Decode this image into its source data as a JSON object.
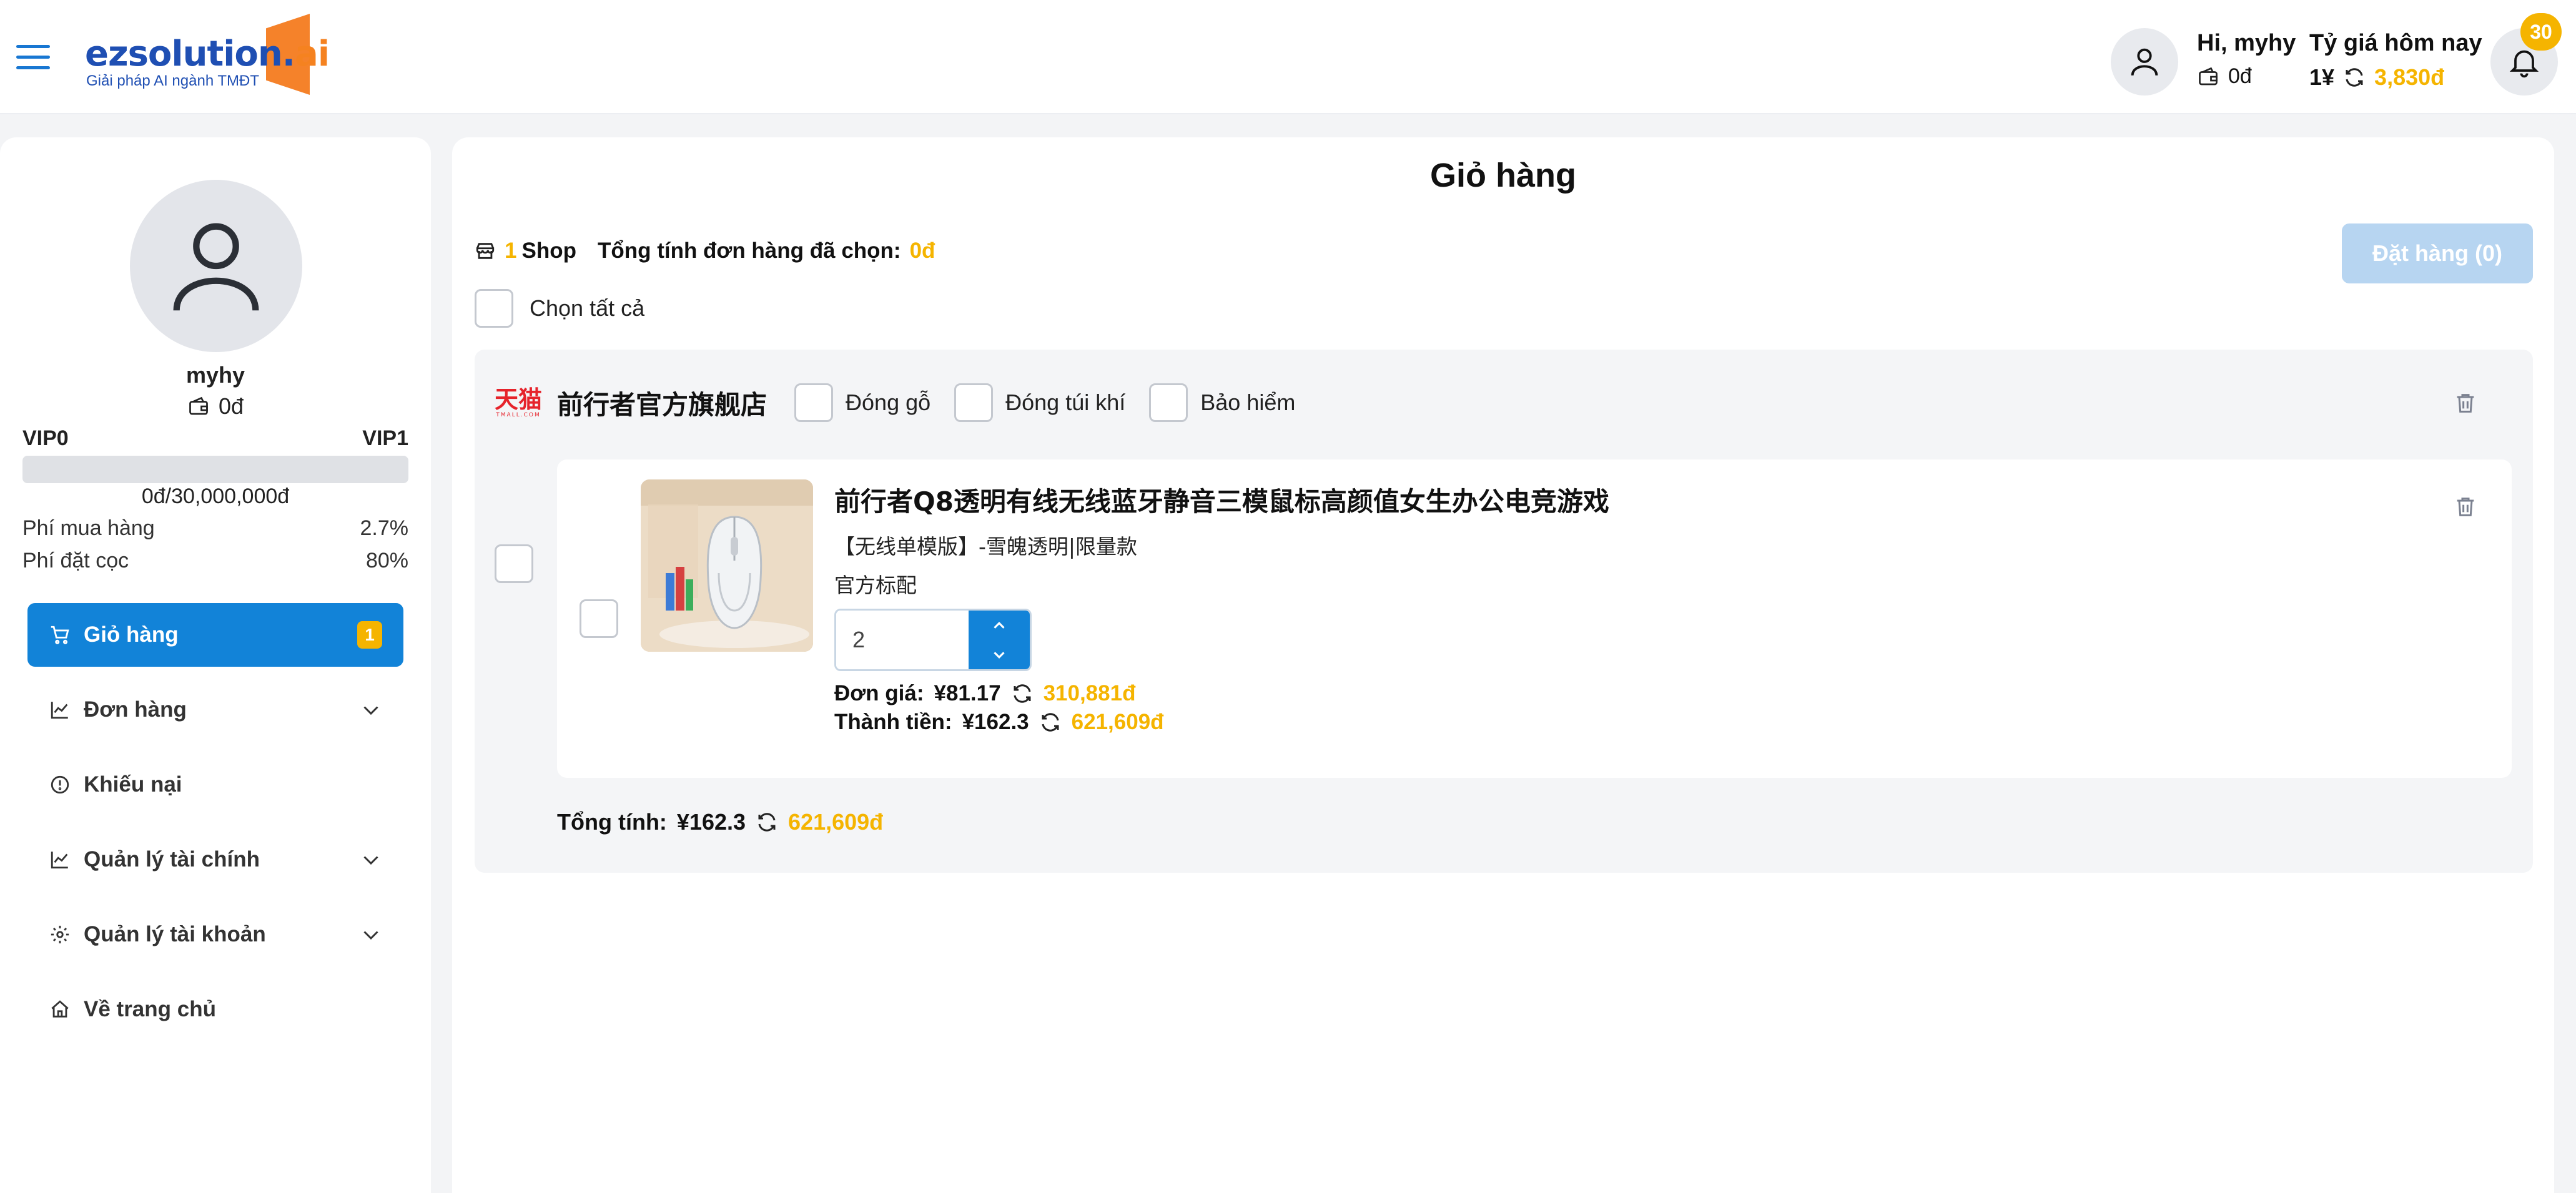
{
  "header": {
    "logo_text": "ezsolution.",
    "logo_ai": "ai",
    "logo_tagline": "Giải pháp AI ngành TMĐT",
    "greeting": "Hi, myhy",
    "wallet_balance": "0đ",
    "rate_label": "Tỷ giá hôm nay",
    "rate_cny": "1¥",
    "rate_vnd": "3,830đ",
    "notification_count": "30"
  },
  "sidebar": {
    "username": "myhy",
    "balance": "0đ",
    "vip_current": "VIP0",
    "vip_next": "VIP1",
    "vip_progress_fraction": 0,
    "vip_progress_text": "0đ/30,000,000đ",
    "fees": [
      {
        "label": "Phí mua hàng",
        "value": "2.7%"
      },
      {
        "label": "Phí đặt cọc",
        "value": "80%"
      }
    ],
    "nav": [
      {
        "label": "Giỏ hàng",
        "icon": "cart-icon",
        "badge": "1",
        "active": true
      },
      {
        "label": "Đơn hàng",
        "icon": "chart-line-icon",
        "expandable": true
      },
      {
        "label": "Khiếu nại",
        "icon": "alert-circle-icon"
      },
      {
        "label": "Quản lý tài chính",
        "icon": "chart-line-icon",
        "expandable": true
      },
      {
        "label": "Quản lý tài khoản",
        "icon": "gear-icon",
        "expandable": true
      },
      {
        "label": "Về trang chủ",
        "icon": "home-icon"
      }
    ]
  },
  "main": {
    "title": "Giỏ hàng",
    "shop_count": "1",
    "shop_word": "Shop",
    "selected_total_label": "Tổng tính đơn hàng đã chọn:",
    "selected_total_value": "0đ",
    "order_button": "Đặt hàng (0)",
    "select_all": "Chọn tất cả",
    "shop": {
      "platform_logo": "天猫",
      "platform_sub": "TMALL.COM",
      "name": "前行者官方旗舰店",
      "options": [
        "Đóng gỗ",
        "Đóng túi khí",
        "Bảo hiểm"
      ],
      "product": {
        "title": "前行者Q8透明有线无线蓝牙静音三模鼠标高颜值女生办公电竞游戏",
        "variant": "【无线单模版】-雪魄透明|限量款",
        "variant2": "官方标配",
        "quantity": "2",
        "unit_price_label": "Đơn giá:",
        "unit_price_cny": "¥81.17",
        "unit_price_vnd": "310,881đ",
        "subtotal_label": "Thành tiền:",
        "subtotal_cny": "¥162.3",
        "subtotal_vnd": "621,609đ"
      },
      "total_label": "Tổng tính:",
      "total_cny": "¥162.3",
      "total_vnd": "621,609đ"
    }
  },
  "colors": {
    "brand_blue": "#1283d8",
    "accent_yellow": "#f5b400",
    "logo_orange": "#f5822a"
  }
}
